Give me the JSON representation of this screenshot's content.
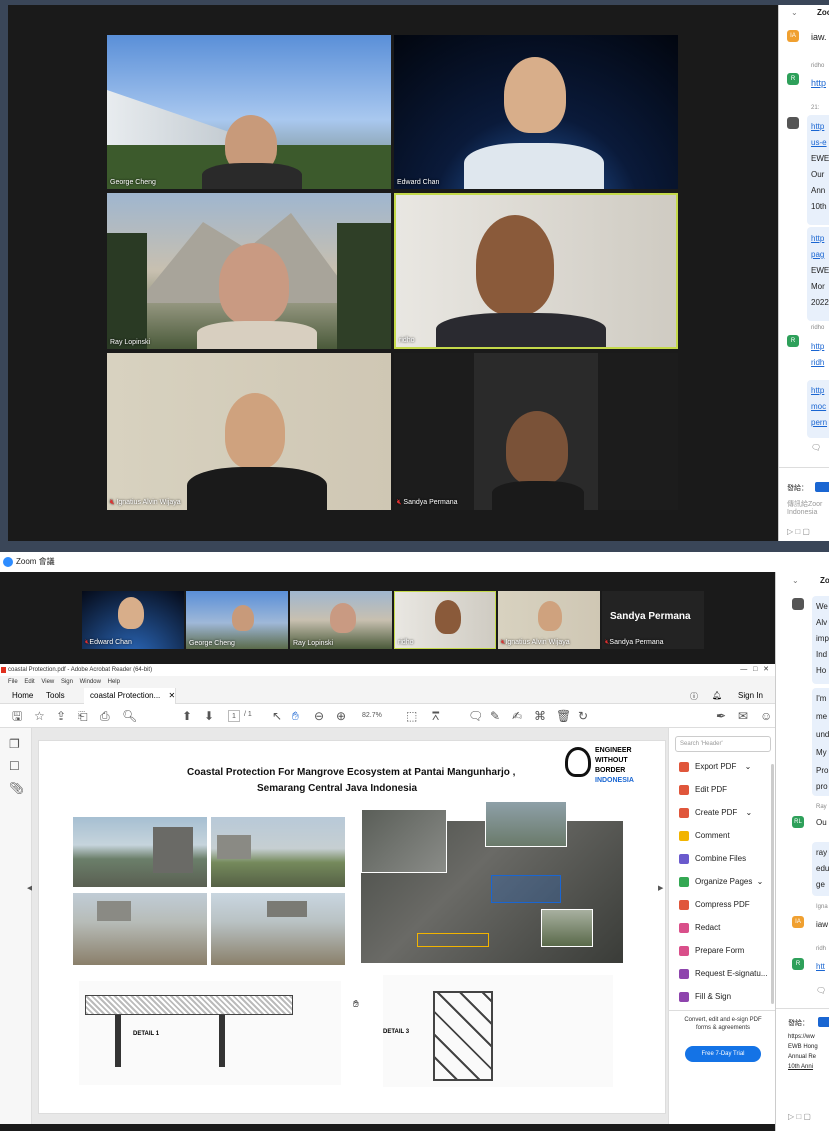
{
  "top_meeting": {
    "participants": [
      {
        "name": "George Cheng",
        "muted": false
      },
      {
        "name": "Edward Chan",
        "muted": false
      },
      {
        "name": "Ray Lopinski",
        "muted": false
      },
      {
        "name": "ridho",
        "muted": false,
        "active_speaker": true
      },
      {
        "name": "Ignatius Alvin Wijaya",
        "muted": true
      },
      {
        "name": "Sandya Permana",
        "muted": true
      }
    ],
    "chat": {
      "header": "Zoo",
      "lines": [
        {
          "sender": "",
          "text": "iaw.",
          "avatar": "IA"
        },
        {
          "sender": "ridho",
          "text": "http",
          "avatar": "R",
          "link": true
        },
        {
          "sender": "",
          "text": "21:",
          "avatar": ""
        },
        {
          "sender": "",
          "text": "http",
          "link": true
        },
        {
          "sender": "",
          "text": "us-e",
          "link": true
        },
        {
          "sender": "",
          "text": "EWE"
        },
        {
          "sender": "",
          "text": "Our"
        },
        {
          "sender": "",
          "text": "Ann"
        },
        {
          "sender": "",
          "text": "10th"
        },
        {
          "sender": "",
          "text": "http",
          "link": true
        },
        {
          "sender": "",
          "text": "pag",
          "link": true
        },
        {
          "sender": "",
          "text": "EWE"
        },
        {
          "sender": "",
          "text": "Mor"
        },
        {
          "sender": "",
          "text": "2022"
        },
        {
          "sender": "ridho",
          "text": "http",
          "avatar": "R",
          "link": true
        },
        {
          "sender": "",
          "text": "ridh",
          "link": true
        },
        {
          "sender": "",
          "text": "http",
          "link": true
        },
        {
          "sender": "",
          "text": "moc",
          "link": true
        },
        {
          "sender": "",
          "text": "pern",
          "link": true
        }
      ],
      "send_to_label": "發給：",
      "footer": "傳訊給Zoor",
      "footer2": "Indonesia"
    }
  },
  "bottom_meeting": {
    "window_title": "Zoom 會議",
    "speaker_label": "Sandya Permana",
    "thumbs": [
      {
        "name": "Edward Chan"
      },
      {
        "name": "George Cheng"
      },
      {
        "name": "Ray Lopinski"
      },
      {
        "name": "ridho"
      },
      {
        "name": "Ignatius Alvin Wijaya"
      },
      {
        "name": "Sandya Permana"
      }
    ],
    "acrobat": {
      "window_title": "coastal Protection.pdf - Adobe Acrobat Reader (64-bit)",
      "menu": [
        "File",
        "Edit",
        "View",
        "Sign",
        "Window",
        "Help"
      ],
      "tabs": [
        "Home",
        "Tools",
        "coastal Protection..."
      ],
      "sign_in": "Sign In",
      "page_current": "1",
      "page_total": "/ 1",
      "zoom": "82.7%",
      "doc_title_line1": "Coastal Protection For Mangrove Ecosystem at Pantai Mangunharjo ,",
      "doc_title_line2": "Semarang Central Java Indonesia",
      "logo_lines": [
        "ENGINEER",
        "WITHOUT",
        "BORDER",
        "INDONESIA"
      ],
      "detail1": "DETAIL 1",
      "detail3": "DETAIL 3",
      "search_placeholder": "Search 'Header'",
      "tools": [
        {
          "label": "Export PDF",
          "color": "#e0563b",
          "chevron": true
        },
        {
          "label": "Edit PDF",
          "color": "#e0563b",
          "chevron": false
        },
        {
          "label": "Create PDF",
          "color": "#e0563b",
          "chevron": true
        },
        {
          "label": "Comment",
          "color": "#f2b400",
          "chevron": false
        },
        {
          "label": "Combine Files",
          "color": "#6a5acd",
          "chevron": false
        },
        {
          "label": "Organize Pages",
          "color": "#34a853",
          "chevron": true
        },
        {
          "label": "Compress PDF",
          "color": "#e0563b",
          "chevron": false
        },
        {
          "label": "Redact",
          "color": "#d94f8a",
          "chevron": false
        },
        {
          "label": "Prepare Form",
          "color": "#d94f8a",
          "chevron": false
        },
        {
          "label": "Request E-signatu...",
          "color": "#8e44ad",
          "chevron": false
        },
        {
          "label": "Fill & Sign",
          "color": "#8e44ad",
          "chevron": false
        }
      ],
      "promo_text": "Convert, edit and e-sign PDF forms & agreements",
      "trial_button": "Free 7-Day Trial"
    },
    "chat": {
      "header": "Zo",
      "lines": [
        {
          "text": "We"
        },
        {
          "text": "Alv"
        },
        {
          "text": "imp"
        },
        {
          "text": "Ind"
        },
        {
          "text": "Ho"
        },
        {
          "text": "I'm"
        },
        {
          "text": "me"
        },
        {
          "text": "und"
        },
        {
          "text": "My"
        },
        {
          "text": "Pro"
        },
        {
          "text": "pro"
        },
        {
          "text": "Ray"
        },
        {
          "text": "Ou"
        },
        {
          "text": "ray"
        },
        {
          "text": "edu"
        },
        {
          "text": "ge"
        },
        {
          "text": "Igna"
        },
        {
          "text": "iaw"
        },
        {
          "text": "ridh"
        },
        {
          "text": "htt"
        }
      ],
      "send_to_label": "發給：",
      "footer_lines": [
        "https://ww",
        "EWB Hong",
        "Annual Re",
        "10th Anni"
      ]
    }
  }
}
